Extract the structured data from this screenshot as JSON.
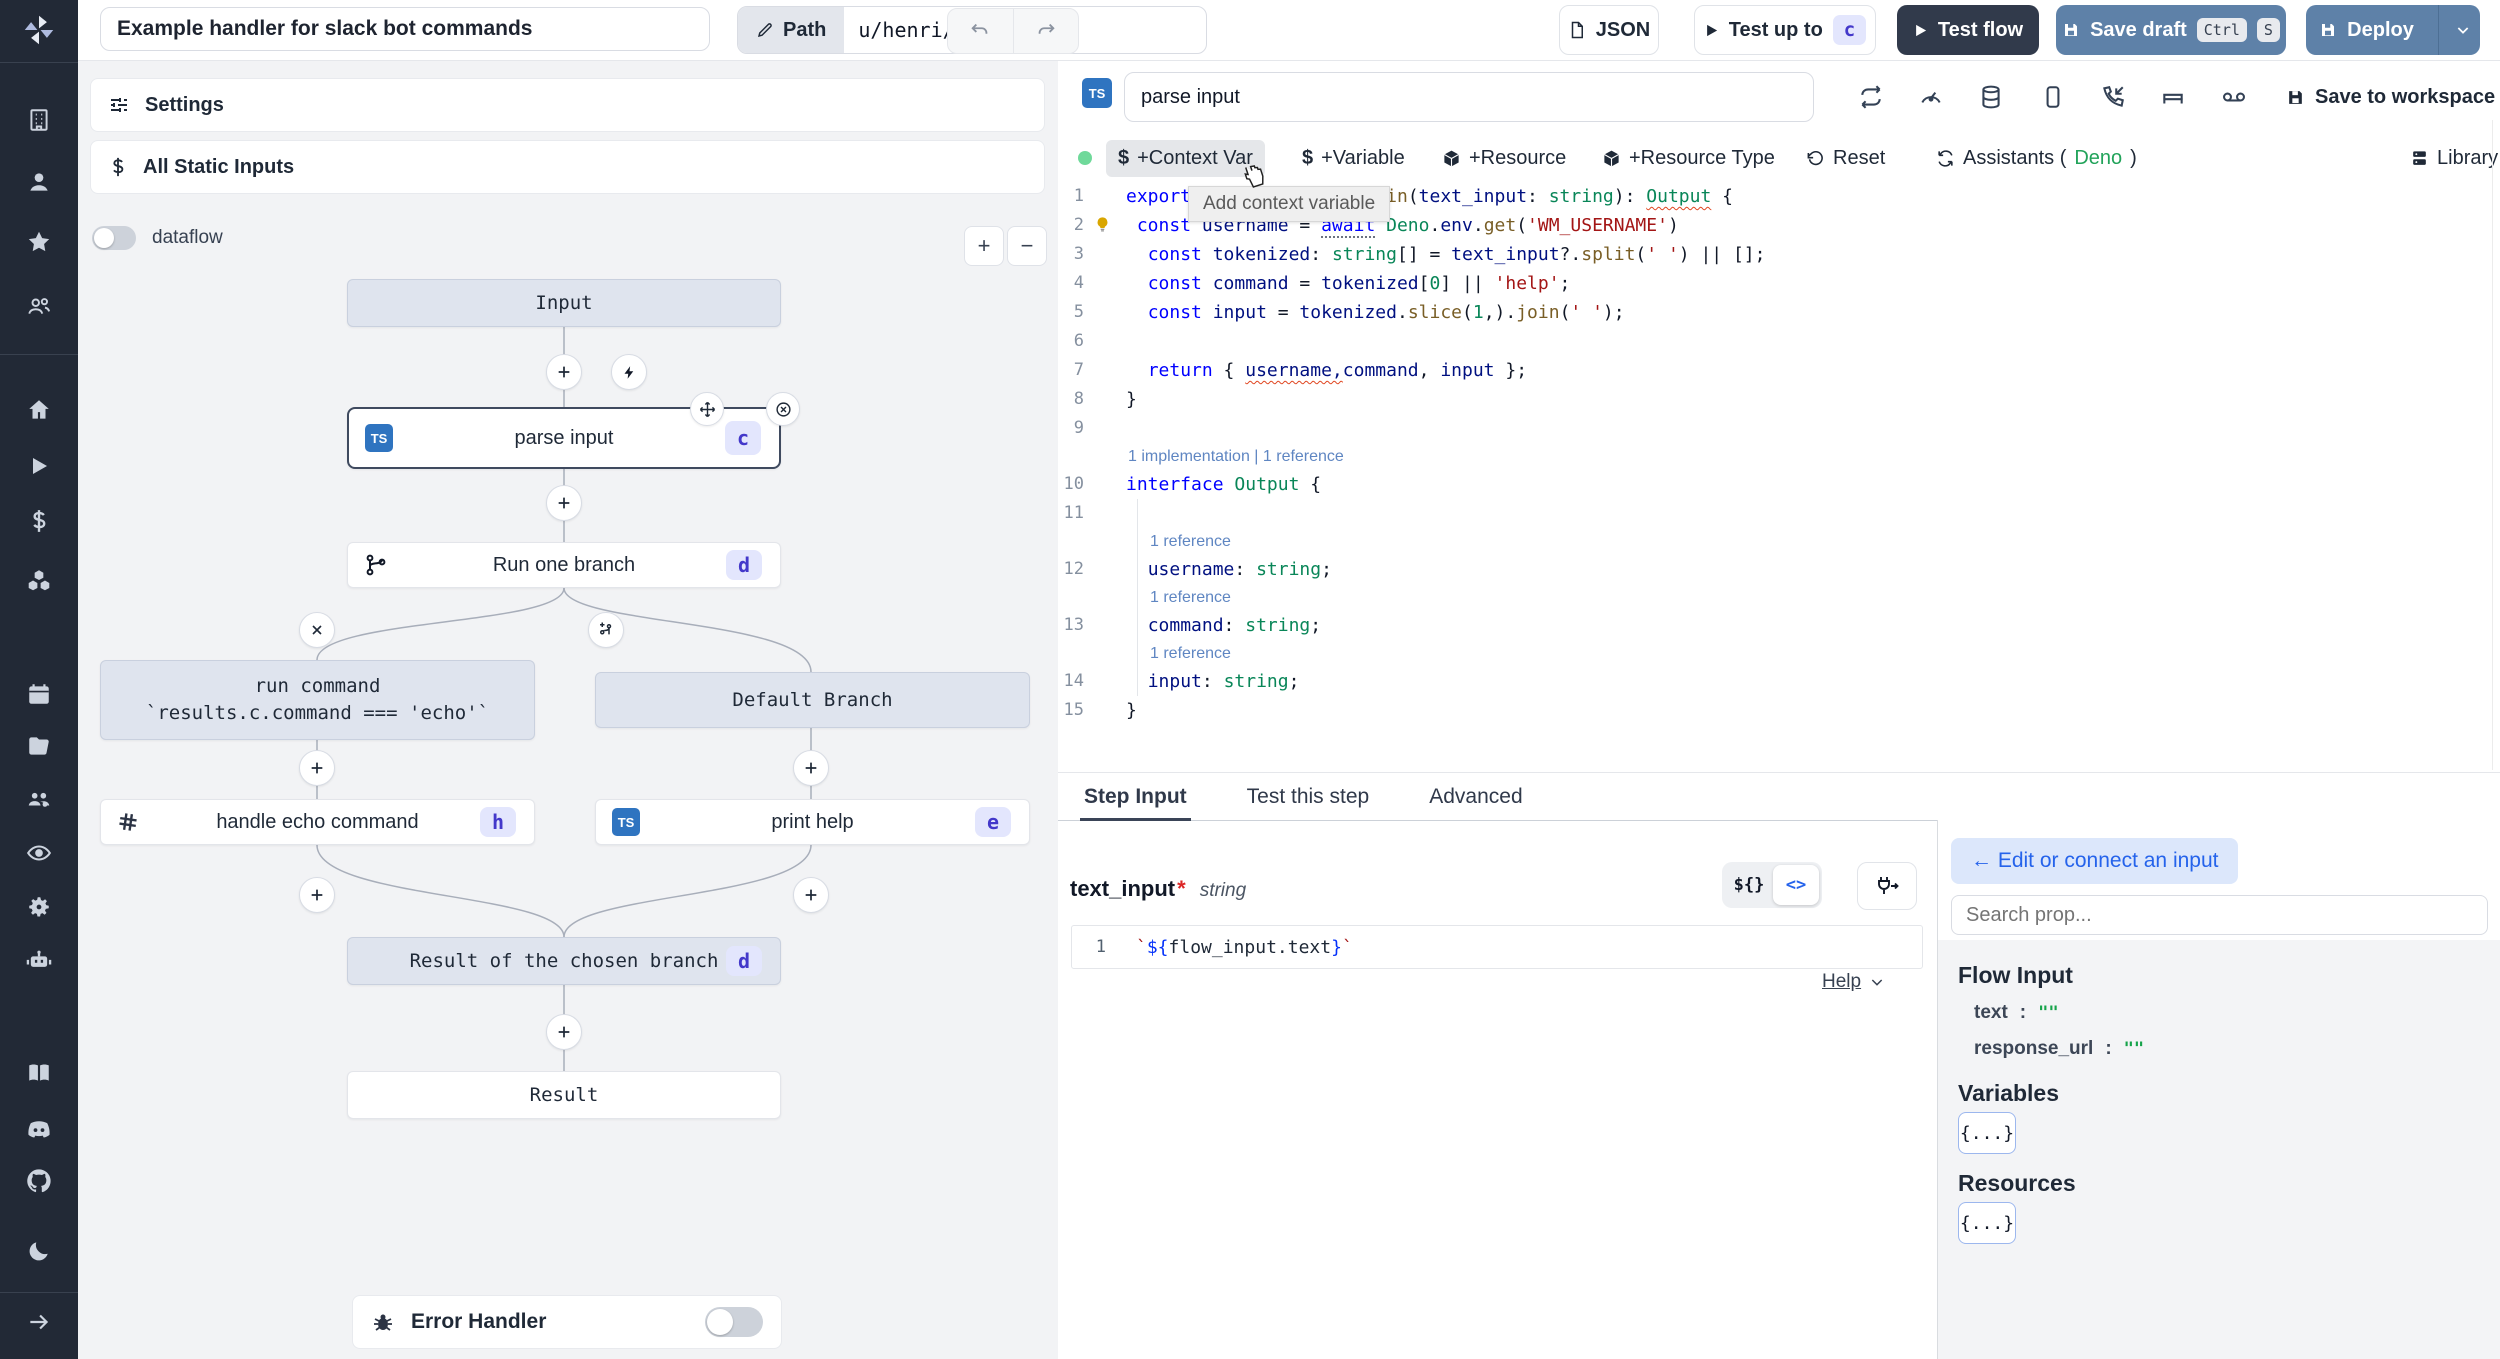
{
  "topbar": {
    "title": "Example handler for slack bot commands",
    "path_label": "Path",
    "path_value": "u/henri/flow_28",
    "json_button": "JSON",
    "test_up_to": "Test up to",
    "test_up_to_badge": "c",
    "test_flow": "Test flow",
    "save_draft": "Save draft",
    "kbd_ctrl": "Ctrl",
    "kbd_s": "S",
    "deploy": "Deploy"
  },
  "flow": {
    "settings": "Settings",
    "all_static_inputs": "All Static Inputs",
    "dataflow": "dataflow",
    "zoom_in": "+",
    "zoom_out": "−",
    "ts_badge": "TS",
    "nodes": {
      "input": "Input",
      "parse_input": {
        "label": "parse input",
        "badge": "c"
      },
      "run_one_branch": {
        "label": "Run one branch",
        "badge": "d"
      },
      "run_command": {
        "line1": "run command",
        "line2": "`results.c.command === 'echo'`"
      },
      "default_branch": "Default Branch",
      "handle_echo": {
        "label": "handle echo command",
        "badge": "h"
      },
      "print_help": {
        "label": "print help",
        "badge": "e"
      },
      "result_chosen": {
        "label": "Result of the chosen branch",
        "badge": "d"
      },
      "result": "Result"
    },
    "error_handler": "Error Handler"
  },
  "editor": {
    "step_name": "parse input",
    "save_to_workspace": "Save to workspace",
    "actions": {
      "context_var": "+Context Var",
      "variable": "+Variable",
      "resource": "+Resource",
      "resource_type": "+Resource Type",
      "reset": "Reset",
      "assistants_prefix": "Assistants (",
      "assistants_lang": "Deno",
      "assistants_suffix": ")",
      "library": "Library"
    },
    "tooltip": "Add context variable",
    "code": {
      "rows": [
        {
          "n": "1",
          "t": [
            [
              "kw",
              "export"
            ],
            [
              "pl",
              " "
            ],
            [
              "kw",
              "async"
            ],
            [
              "pl",
              " "
            ],
            [
              "kw",
              "function"
            ],
            [
              "pl",
              " "
            ],
            [
              "fn",
              "main"
            ],
            [
              "pun",
              "("
            ],
            [
              "var",
              "text_input"
            ],
            [
              "pun",
              ": "
            ],
            [
              "type",
              "string"
            ],
            [
              "pun",
              "): "
            ],
            [
              "type",
              "Output",
              "sq"
            ],
            [
              "pun",
              " {"
            ]
          ]
        },
        {
          "n": "2",
          "bulb": true,
          "t": [
            [
              "pl",
              " "
            ],
            [
              "kw",
              "const"
            ],
            [
              "pl",
              " "
            ],
            [
              "var",
              "username"
            ],
            [
              "pun",
              " = "
            ],
            [
              "kw",
              "await",
              "dots"
            ],
            [
              "pl",
              " "
            ],
            [
              "type",
              "Deno"
            ],
            [
              "pun",
              "."
            ],
            [
              "var",
              "env"
            ],
            [
              "pun",
              "."
            ],
            [
              "fn",
              "get"
            ],
            [
              "pun",
              "("
            ],
            [
              "str",
              "'WM_USERNAME'"
            ],
            [
              "pun",
              ")"
            ]
          ]
        },
        {
          "n": "3",
          "t": [
            [
              "pl",
              "  "
            ],
            [
              "kw",
              "const"
            ],
            [
              "pl",
              " "
            ],
            [
              "var",
              "tokenized"
            ],
            [
              "pun",
              ": "
            ],
            [
              "type",
              "string"
            ],
            [
              "pun",
              "[] = "
            ],
            [
              "var",
              "text_input"
            ],
            [
              "pun",
              "?."
            ],
            [
              "fn",
              "split"
            ],
            [
              "pun",
              "("
            ],
            [
              "str",
              "' '"
            ],
            [
              "pun",
              ") || [];"
            ]
          ]
        },
        {
          "n": "4",
          "t": [
            [
              "pl",
              "  "
            ],
            [
              "kw",
              "const"
            ],
            [
              "pl",
              " "
            ],
            [
              "var",
              "command"
            ],
            [
              "pun",
              " = "
            ],
            [
              "var",
              "tokenized"
            ],
            [
              "pun",
              "["
            ],
            [
              "num",
              "0"
            ],
            [
              "pun",
              "] || "
            ],
            [
              "str",
              "'help'"
            ],
            [
              "pun",
              ";"
            ]
          ]
        },
        {
          "n": "5",
          "t": [
            [
              "pl",
              "  "
            ],
            [
              "kw",
              "const"
            ],
            [
              "pl",
              " "
            ],
            [
              "var",
              "input"
            ],
            [
              "pun",
              " = "
            ],
            [
              "var",
              "tokenized"
            ],
            [
              "pun",
              "."
            ],
            [
              "fn",
              "slice"
            ],
            [
              "pun",
              "("
            ],
            [
              "num",
              "1"
            ],
            [
              "pun",
              ",)."
            ],
            [
              "fn",
              "join"
            ],
            [
              "pun",
              "("
            ],
            [
              "str",
              "' '"
            ],
            [
              "pun",
              ");"
            ]
          ]
        },
        {
          "n": "6",
          "t": []
        },
        {
          "n": "7",
          "t": [
            [
              "pl",
              "  "
            ],
            [
              "kw",
              "return"
            ],
            [
              "pun",
              " { "
            ],
            [
              "var",
              "username,",
              "sq"
            ],
            [
              "var",
              "command"
            ],
            [
              "pun",
              ", "
            ],
            [
              "var",
              "input"
            ],
            [
              "pun",
              " };"
            ]
          ]
        },
        {
          "n": "8",
          "t": [
            [
              "pun",
              "}"
            ]
          ]
        },
        {
          "n": "9",
          "t": []
        },
        {
          "lens": "1 implementation | 1 reference",
          "ind": 0
        },
        {
          "n": "10",
          "t": [
            [
              "kw",
              "interface"
            ],
            [
              "pl",
              " "
            ],
            [
              "type",
              "Output"
            ],
            [
              "pun",
              " {"
            ]
          ]
        },
        {
          "n": "11",
          "g": true,
          "t": []
        },
        {
          "lens": "1 reference",
          "ind": 1,
          "g": true
        },
        {
          "n": "12",
          "g": true,
          "t": [
            [
              "pl",
              "  "
            ],
            [
              "var",
              "username"
            ],
            [
              "pun",
              ": "
            ],
            [
              "type",
              "string"
            ],
            [
              "pun",
              ";"
            ]
          ]
        },
        {
          "lens": "1 reference",
          "ind": 1,
          "g": true
        },
        {
          "n": "13",
          "g": true,
          "t": [
            [
              "pl",
              "  "
            ],
            [
              "var",
              "command"
            ],
            [
              "pun",
              ": "
            ],
            [
              "type",
              "string"
            ],
            [
              "pun",
              ";"
            ]
          ]
        },
        {
          "lens": "1 reference",
          "ind": 1,
          "g": true
        },
        {
          "n": "14",
          "g": true,
          "t": [
            [
              "pl",
              "  "
            ],
            [
              "var",
              "input"
            ],
            [
              "pun",
              ": "
            ],
            [
              "type",
              "string"
            ],
            [
              "pun",
              ";"
            ]
          ]
        },
        {
          "n": "15",
          "t": [
            [
              "pun",
              "}"
            ]
          ]
        }
      ]
    }
  },
  "panel": {
    "tabs": [
      {
        "label": "Step Input"
      },
      {
        "label": "Test this step"
      },
      {
        "label": "Advanced"
      }
    ],
    "field": {
      "name": "text_input",
      "required": "*",
      "type": "string",
      "line_no": "1",
      "expr": [
        [
          "btick",
          "`"
        ],
        [
          "brace",
          "${"
        ],
        [
          "plain",
          "flow_input.text"
        ],
        [
          "brace",
          "}"
        ],
        [
          "btick",
          "`"
        ]
      ],
      "toggle_json": "${}",
      "toggle_code": "<>",
      "help": "Help"
    }
  },
  "right": {
    "edit_connect": "← Edit or connect an input",
    "search_placeholder": "Search prop...",
    "flow_input_title": "Flow Input",
    "props": [
      {
        "name": "text",
        "colon": ":",
        "value": "\"\""
      },
      {
        "name": "response_url",
        "colon": ":",
        "value": "\"\""
      }
    ],
    "variables_title": "Variables",
    "resources_title": "Resources",
    "braces": "{...}"
  }
}
